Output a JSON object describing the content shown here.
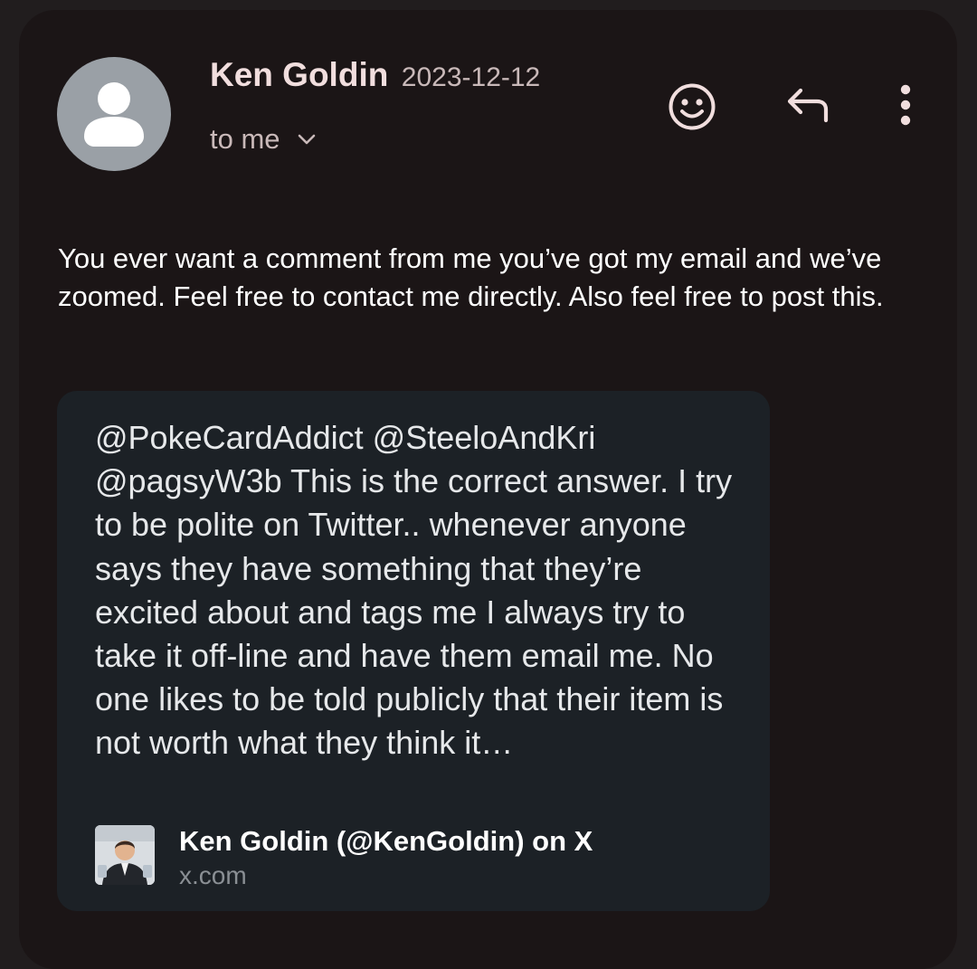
{
  "message": {
    "sender_name": "Ken Goldin",
    "date": "2023-12-12",
    "recipients": "to me",
    "body": "You ever want a comment from me you’ve got my email and we’ve zoomed. Feel free to contact me directly. Also feel free to post this.",
    "icons": {
      "avatar": "person-avatar-icon",
      "emoji": "emoji-reaction-icon",
      "reply": "reply-icon",
      "more": "more-vert-icon",
      "recipients_toggle": "chevron-down-icon"
    }
  },
  "link_preview": {
    "text": "@PokeCardAddict @SteeloAndKri @pagsyW3b This is the correct answer. I try to be polite on Twitter.. whenever anyone says they have something that they’re excited about and tags me I always try to take it off-line and have them email me. No one likes to be told publicly that their item is not worth what they think it…",
    "title": "Ken Goldin (@KenGoldin) on X",
    "domain": "x.com"
  },
  "colors": {
    "page_background": "#211d1e",
    "card_background": "#1b1516",
    "preview_background": "#1c2126",
    "sender_text": "#f1dede",
    "secondary_text": "#c9b9b9",
    "avatar_background": "#9aa0a6"
  }
}
